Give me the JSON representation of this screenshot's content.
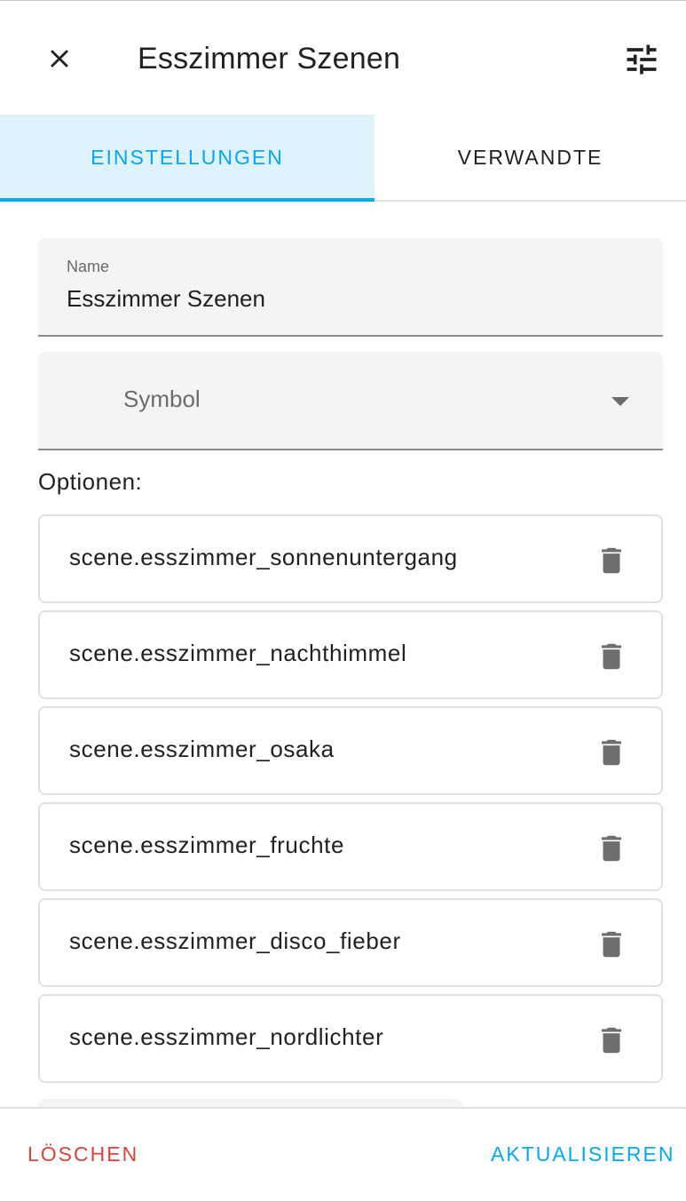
{
  "dialog": {
    "title": "Esszimmer Szenen",
    "close_icon": "close-icon",
    "settings_icon": "tune-icon"
  },
  "tabs": [
    {
      "label": "EINSTELLUNGEN",
      "active": true
    },
    {
      "label": "VERWANDTE",
      "active": false
    }
  ],
  "form": {
    "name_label": "Name",
    "name_value": "Esszimmer Szenen",
    "symbol_placeholder": "Symbol",
    "options_label": "Optionen:"
  },
  "options": [
    {
      "value": "scene.esszimmer_sonnenuntergang"
    },
    {
      "value": "scene.esszimmer_nachthimmel"
    },
    {
      "value": "scene.esszimmer_osaka"
    },
    {
      "value": "scene.esszimmer_fruchte"
    },
    {
      "value": "scene.esszimmer_disco_fieber"
    },
    {
      "value": "scene.esszimmer_nordlichter"
    }
  ],
  "footer": {
    "delete_label": "LÖSCHEN",
    "update_label": "AKTUALISIEREN"
  },
  "colors": {
    "accent": "#03a9f4",
    "accent_tab_bg": "#dff2fb",
    "danger": "#db4437",
    "icon_grey": "#6f6f6f"
  }
}
